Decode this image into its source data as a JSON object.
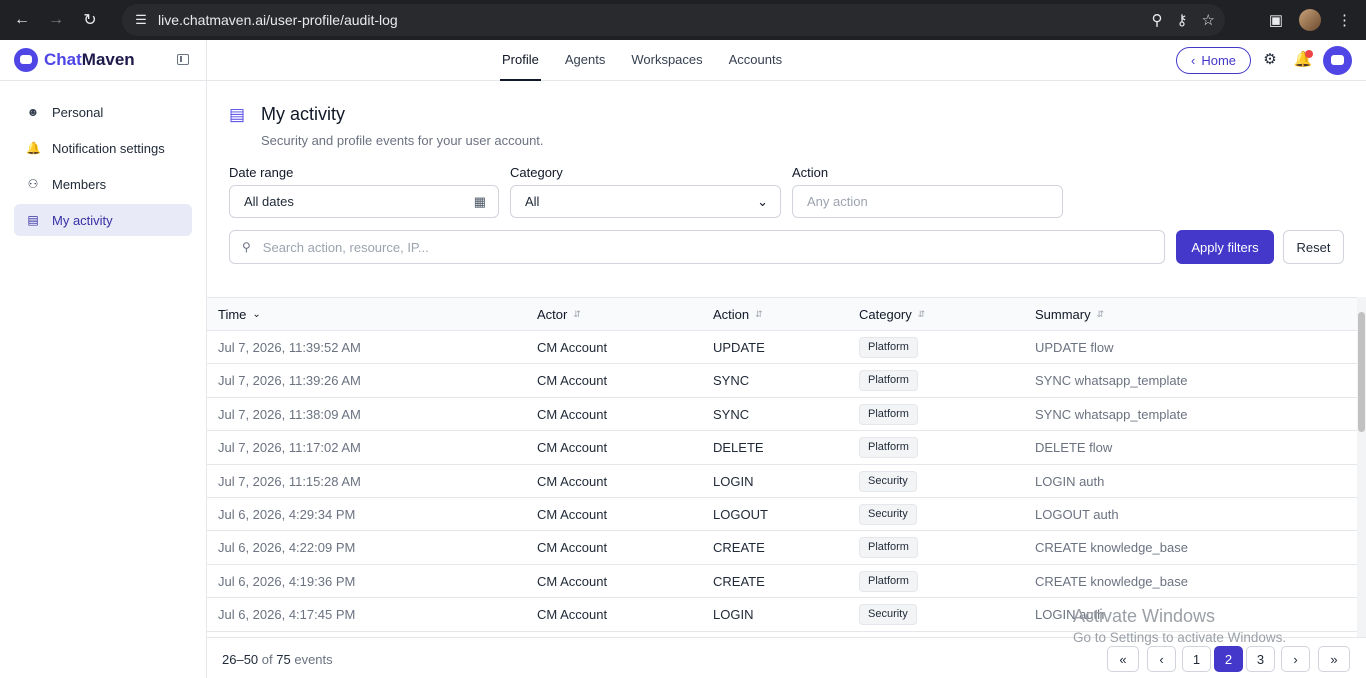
{
  "browser": {
    "url": "live.chatmaven.ai/user-profile/audit-log"
  },
  "app": {
    "brand_first": "Chat",
    "brand_second": "Maven",
    "top_tabs": [
      {
        "label": "Profile"
      },
      {
        "label": "Agents"
      },
      {
        "label": "Workspaces"
      },
      {
        "label": "Accounts"
      }
    ],
    "home_label": "Home",
    "accent": "#4338ca"
  },
  "sidebar": {
    "items": [
      {
        "label": "Personal",
        "icon": "user-icon"
      },
      {
        "label": "Notification settings",
        "icon": "bell-icon"
      },
      {
        "label": "Members",
        "icon": "users-icon"
      },
      {
        "label": "My activity",
        "icon": "clipboard-icon"
      }
    ]
  },
  "main": {
    "title": "My activity",
    "subtitle": "Security and profile events for your user account.",
    "filters": {
      "date_label": "Date range",
      "date_value": "All dates",
      "category_label": "Category",
      "category_value": "All",
      "action_label": "Action",
      "action_placeholder": "Any action",
      "search_placeholder": "Search action, resource, IP...",
      "apply_label": "Apply filters",
      "reset_label": "Reset"
    },
    "columns": {
      "time": "Time",
      "actor": "Actor",
      "action": "Action",
      "category": "Category",
      "summary": "Summary"
    },
    "rows": [
      {
        "time": "Jul 7, 2026, 11:39:52 AM",
        "actor": "CM Account",
        "action": "UPDATE",
        "category": "Platform",
        "summary": "UPDATE flow"
      },
      {
        "time": "Jul 7, 2026, 11:39:26 AM",
        "actor": "CM Account",
        "action": "SYNC",
        "category": "Platform",
        "summary": "SYNC whatsapp_template"
      },
      {
        "time": "Jul 7, 2026, 11:38:09 AM",
        "actor": "CM Account",
        "action": "SYNC",
        "category": "Platform",
        "summary": "SYNC whatsapp_template"
      },
      {
        "time": "Jul 7, 2026, 11:17:02 AM",
        "actor": "CM Account",
        "action": "DELETE",
        "category": "Platform",
        "summary": "DELETE flow"
      },
      {
        "time": "Jul 7, 2026, 11:15:28 AM",
        "actor": "CM Account",
        "action": "LOGIN",
        "category": "Security",
        "summary": "LOGIN auth"
      },
      {
        "time": "Jul 6, 2026, 4:29:34 PM",
        "actor": "CM Account",
        "action": "LOGOUT",
        "category": "Security",
        "summary": "LOGOUT auth"
      },
      {
        "time": "Jul 6, 2026, 4:22:09 PM",
        "actor": "CM Account",
        "action": "CREATE",
        "category": "Platform",
        "summary": "CREATE knowledge_base"
      },
      {
        "time": "Jul 6, 2026, 4:19:36 PM",
        "actor": "CM Account",
        "action": "CREATE",
        "category": "Platform",
        "summary": "CREATE knowledge_base"
      },
      {
        "time": "Jul 6, 2026, 4:17:45 PM",
        "actor": "CM Account",
        "action": "LOGIN",
        "category": "Security",
        "summary": "LOGIN auth"
      }
    ],
    "footer": {
      "range": "26–50",
      "of": "of",
      "total": "75",
      "unit": "events",
      "pages": [
        "1",
        "2",
        "3"
      ],
      "current_page": "2"
    }
  },
  "watermark": {
    "line1": "Activate Windows",
    "line2": "Go to Settings to activate Windows."
  }
}
